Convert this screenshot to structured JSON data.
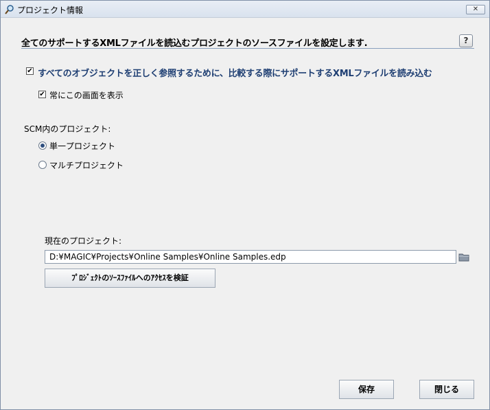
{
  "window": {
    "title": "プロジェクト情報",
    "close_label": "✕"
  },
  "header": {
    "text": "全てのサポートするXMLファイルを読込むプロジェクトのソースファイルを設定します.",
    "help_label": "?"
  },
  "options": {
    "load_xml": {
      "label": "すべてのオブジェクトを正しく参照するために、比較する際にサポートするXMLファイルを読み込む",
      "checked": true
    },
    "always_show": {
      "label": "常にこの画面を表示",
      "checked": true
    }
  },
  "scm": {
    "group_label": "SCM内のプロジェクト:",
    "single_label": "単一プロジェクト",
    "multi_label": "マルチプロジェクト",
    "selected": "single"
  },
  "project": {
    "label": "現在のプロジェクト:",
    "path": "D:¥MAGIC¥Projects¥Online Samples¥Online Samples.edp",
    "verify_label": "ﾌﾟﾛｼﾞｪｸﾄのｿｰｽﾌｧｲﾙへのｱｸｾｽを検証"
  },
  "footer": {
    "save_label": "保存",
    "close_label": "閉じる"
  },
  "icons": {
    "title_icon": "magnifier-icon",
    "folder_icon": "folder-icon",
    "check_mark": "✔"
  },
  "colors": {
    "primary_text": "#1f3f73",
    "rule": "#8aa0bd"
  }
}
